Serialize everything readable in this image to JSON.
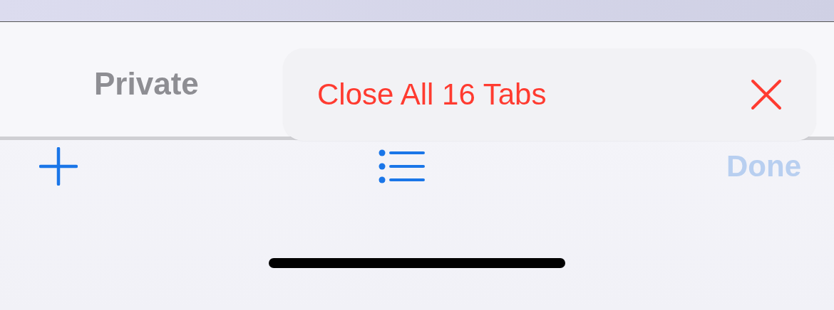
{
  "tab_switcher": {
    "label": "Private",
    "selected": false
  },
  "menu": {
    "items": [
      {
        "label": "Close All 16 Tabs",
        "kind": "destructive"
      }
    ]
  },
  "toolbar": {
    "done": {
      "label": "Done",
      "disabled": true
    }
  }
}
